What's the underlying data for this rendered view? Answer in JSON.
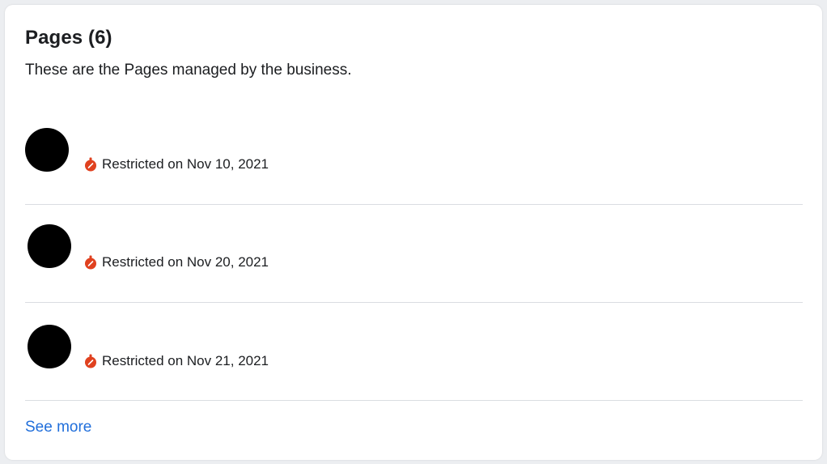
{
  "section": {
    "title": "Pages (6)",
    "subtitle": "These are the Pages managed by the business."
  },
  "pages": [
    {
      "status_text": "Restricted on Nov 10, 2021",
      "status_icon": "restricted-icon"
    },
    {
      "status_text": "Restricted on Nov 20, 2021",
      "status_icon": "restricted-icon"
    },
    {
      "status_text": "Restricted on Nov 21, 2021",
      "status_icon": "restricted-icon"
    }
  ],
  "see_more_label": "See more",
  "colors": {
    "restricted_icon": "#e0411f",
    "link": "#216fdb",
    "divider": "#dadde1"
  }
}
